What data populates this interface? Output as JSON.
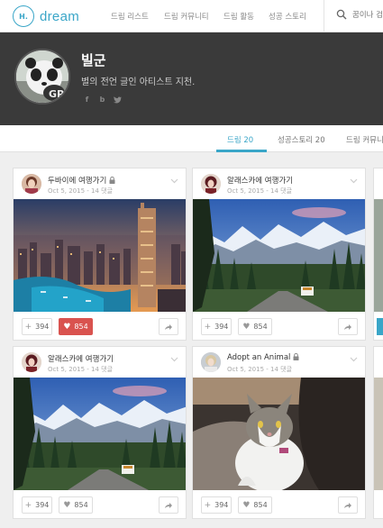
{
  "brand": {
    "logo_mark": "H.",
    "name": "dream"
  },
  "nav": {
    "links": [
      "드림 리스트",
      "드림 커뮤니티",
      "드림 활동",
      "성공 스토리"
    ],
    "search_placeholder": "꿈이나 검색"
  },
  "profile": {
    "name": "빌군",
    "bio": "별의 전언 글인 아티스트 지천.",
    "socials": [
      "facebook-icon",
      "blog-icon",
      "twitter-icon"
    ]
  },
  "tabs": [
    {
      "label": "드림 20",
      "active": true
    },
    {
      "label": "성공스토리 20",
      "active": false
    },
    {
      "label": "드림 커뮤니티",
      "active": false
    }
  ],
  "cards": [
    {
      "title": "두바이에 여행가기",
      "locked": true,
      "meta": "Oct 5, 2015 - 14 댓글",
      "adds": "394",
      "likes": "854",
      "liked": true,
      "image": "dubai"
    },
    {
      "title": "알래스카에 여행가기",
      "locked": false,
      "meta": "Oct 5, 2015 - 14 댓글",
      "adds": "394",
      "likes": "854",
      "liked": false,
      "image": "alaska"
    },
    {
      "title": "알래스카에 여행가기",
      "locked": false,
      "meta": "Oct 5, 2015 - 14 댓글",
      "adds": "394",
      "likes": "854",
      "liked": false,
      "image": "alaska"
    },
    {
      "title": "Adopt an Animal",
      "locked": true,
      "meta": "Oct 5, 2015 - 14 댓글",
      "adds": "394",
      "likes": "854",
      "liked": false,
      "image": "cat"
    }
  ],
  "colors": {
    "accent": "#3aa6c8",
    "banner": "#3a3a3a",
    "like_active": "#d9534f",
    "page_bg": "#efefef"
  }
}
